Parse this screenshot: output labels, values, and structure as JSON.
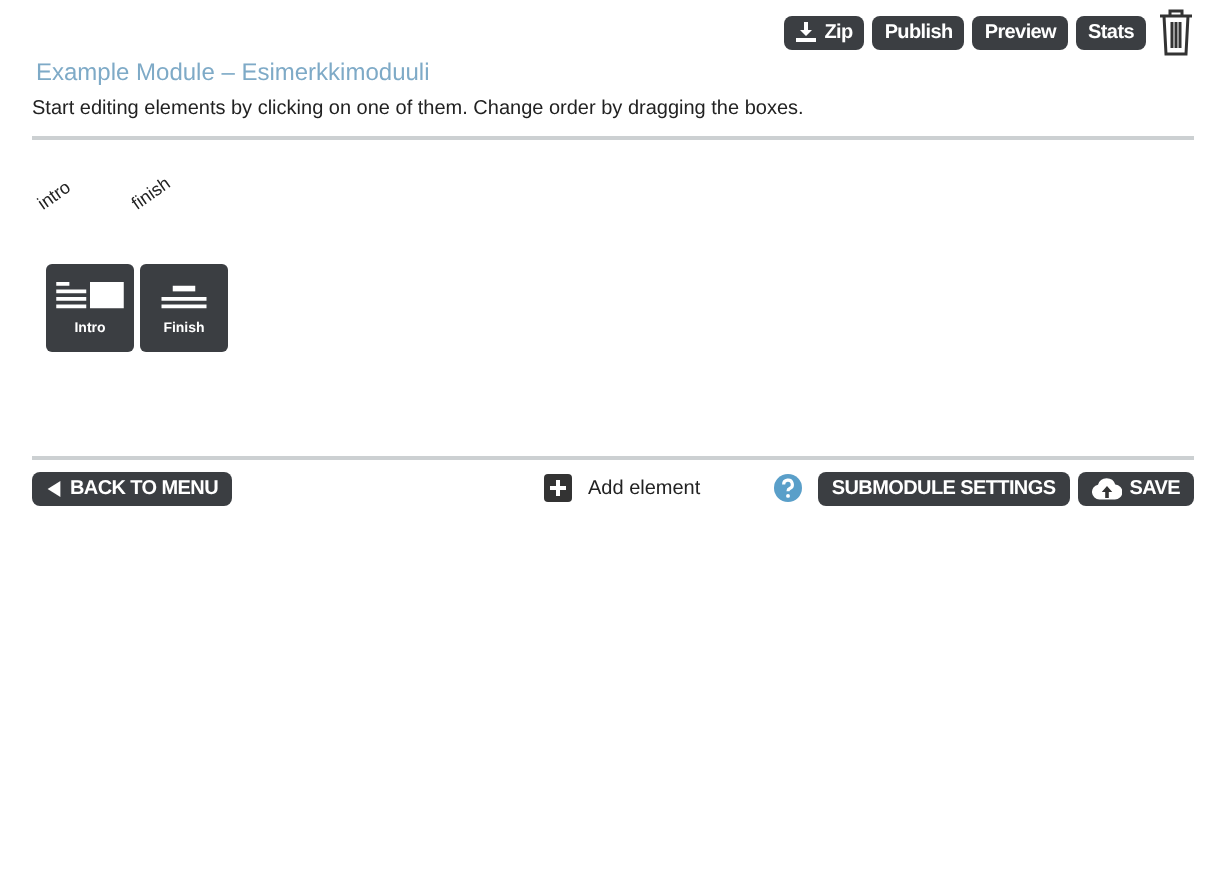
{
  "toolbar": {
    "buttons": [
      {
        "label": "Zip",
        "kind": "download"
      },
      {
        "label": "Publish",
        "kind": "plain"
      },
      {
        "label": "Preview",
        "kind": "plain"
      },
      {
        "label": "Stats",
        "kind": "plain"
      }
    ]
  },
  "module": {
    "title": "Example Module – Esimerkkimoduuli",
    "instructions": "Start editing elements by clicking on one of them. Change order by dragging the boxes."
  },
  "elements": [
    {
      "name": "intro",
      "label": "Intro",
      "kind": "intro"
    },
    {
      "name": "finish",
      "label": "Finish",
      "kind": "finish"
    }
  ],
  "footer": {
    "back": "BACK TO MENU",
    "add": "Add element",
    "settings": "SUBMODULE SETTINGS",
    "save": "SAVE"
  }
}
